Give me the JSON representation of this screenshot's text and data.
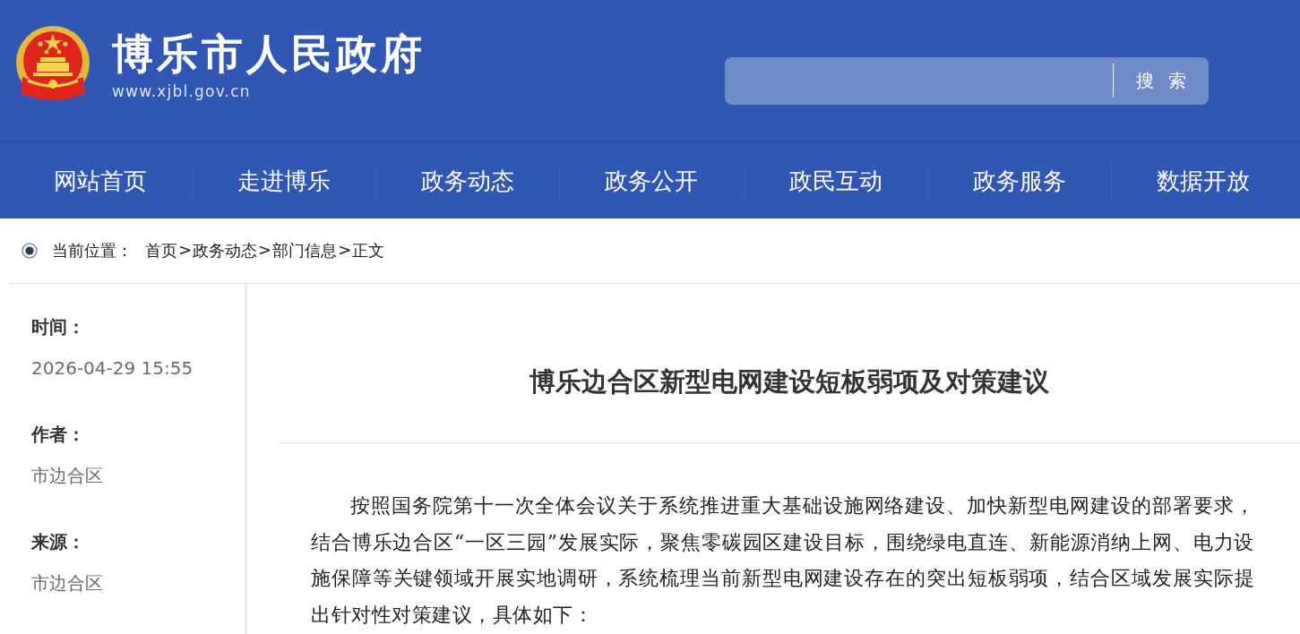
{
  "header": {
    "site_title": "博乐市人民政府",
    "site_url": "www.xjbl.gov.cn",
    "search": {
      "button": "搜索"
    }
  },
  "nav": [
    {
      "label": "网站首页"
    },
    {
      "label": "走进博乐"
    },
    {
      "label": "政务动态"
    },
    {
      "label": "政务公开"
    },
    {
      "label": "政民互动"
    },
    {
      "label": "政务服务"
    },
    {
      "label": "数据开放"
    }
  ],
  "breadcrumb": {
    "label": "当前位置：",
    "items": [
      {
        "text": "首页",
        "separator": ">"
      },
      {
        "text": "政务动态",
        "separator": ">"
      },
      {
        "text": "部门信息",
        "separator": ">"
      },
      {
        "text": "正文"
      }
    ]
  },
  "meta": [
    {
      "label": "时间：",
      "value": "2026-04-29 15:55"
    },
    {
      "label": "作者：",
      "value": "市边合区"
    },
    {
      "label": "来源：",
      "value": "市边合区"
    }
  ],
  "article": {
    "title": "博乐边合区新型电网建设短板弱项及对策建议",
    "paragraphs": [
      "按照国务院第十一次全体会议关于系统推进重大基础设施网络建设、加快新型电网建设的部署要求，结合博乐边合区“一区三园”发展实际，聚焦零碳园区建设目标，围绕绿电直连、新能源消纳上网、电力设施保障等关键领域开展实地调研，系统梳理当前新型电网建设存在的突出短板弱项，结合区域发展实际提出针对性对策建议，具体如下："
    ]
  }
}
